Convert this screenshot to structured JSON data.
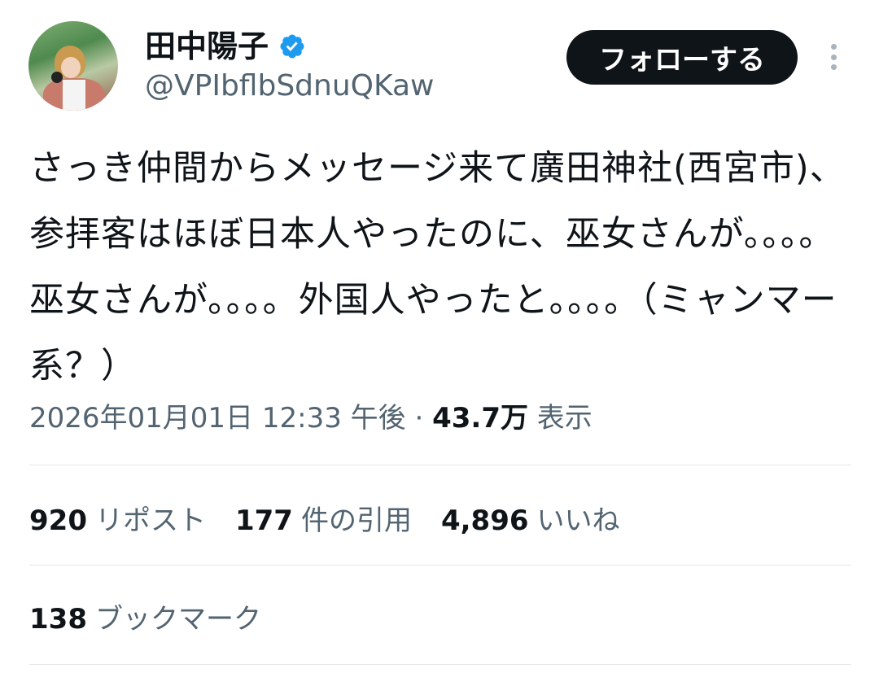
{
  "author": {
    "display_name": "田中陽子",
    "handle": "@VPIbflbSdnuQKaw",
    "verified_icon": "verified-badge-icon",
    "verified_color": "#1d9bf0"
  },
  "follow_button": {
    "label": "フォローする"
  },
  "more_menu": {
    "icon": "vertical-ellipsis-icon"
  },
  "tweet": {
    "text": "さっき仲間からメッセージ来て廣田神社(西宮市)、参拝客はほぼ日本人やったのに、巫女さんが。。。。巫女さんが。。。。外国人やったと。。。。（ミャンマー系？）"
  },
  "meta": {
    "timestamp": "2026年01月01日 12:33 午後",
    "separator": "·",
    "views_count": "43.7万",
    "views_label": "表示"
  },
  "stats": {
    "reposts": {
      "count": "920",
      "label": "リポスト"
    },
    "quotes": {
      "count": "177",
      "label": "件の引用"
    },
    "likes": {
      "count": "4,896",
      "label": "いいね"
    },
    "bookmarks": {
      "count": "138",
      "label": "ブックマーク"
    }
  },
  "colors": {
    "text_primary": "#0f1419",
    "text_secondary": "#536471",
    "divider": "#e1e6ea",
    "follow_button_bg": "#0f1419"
  }
}
